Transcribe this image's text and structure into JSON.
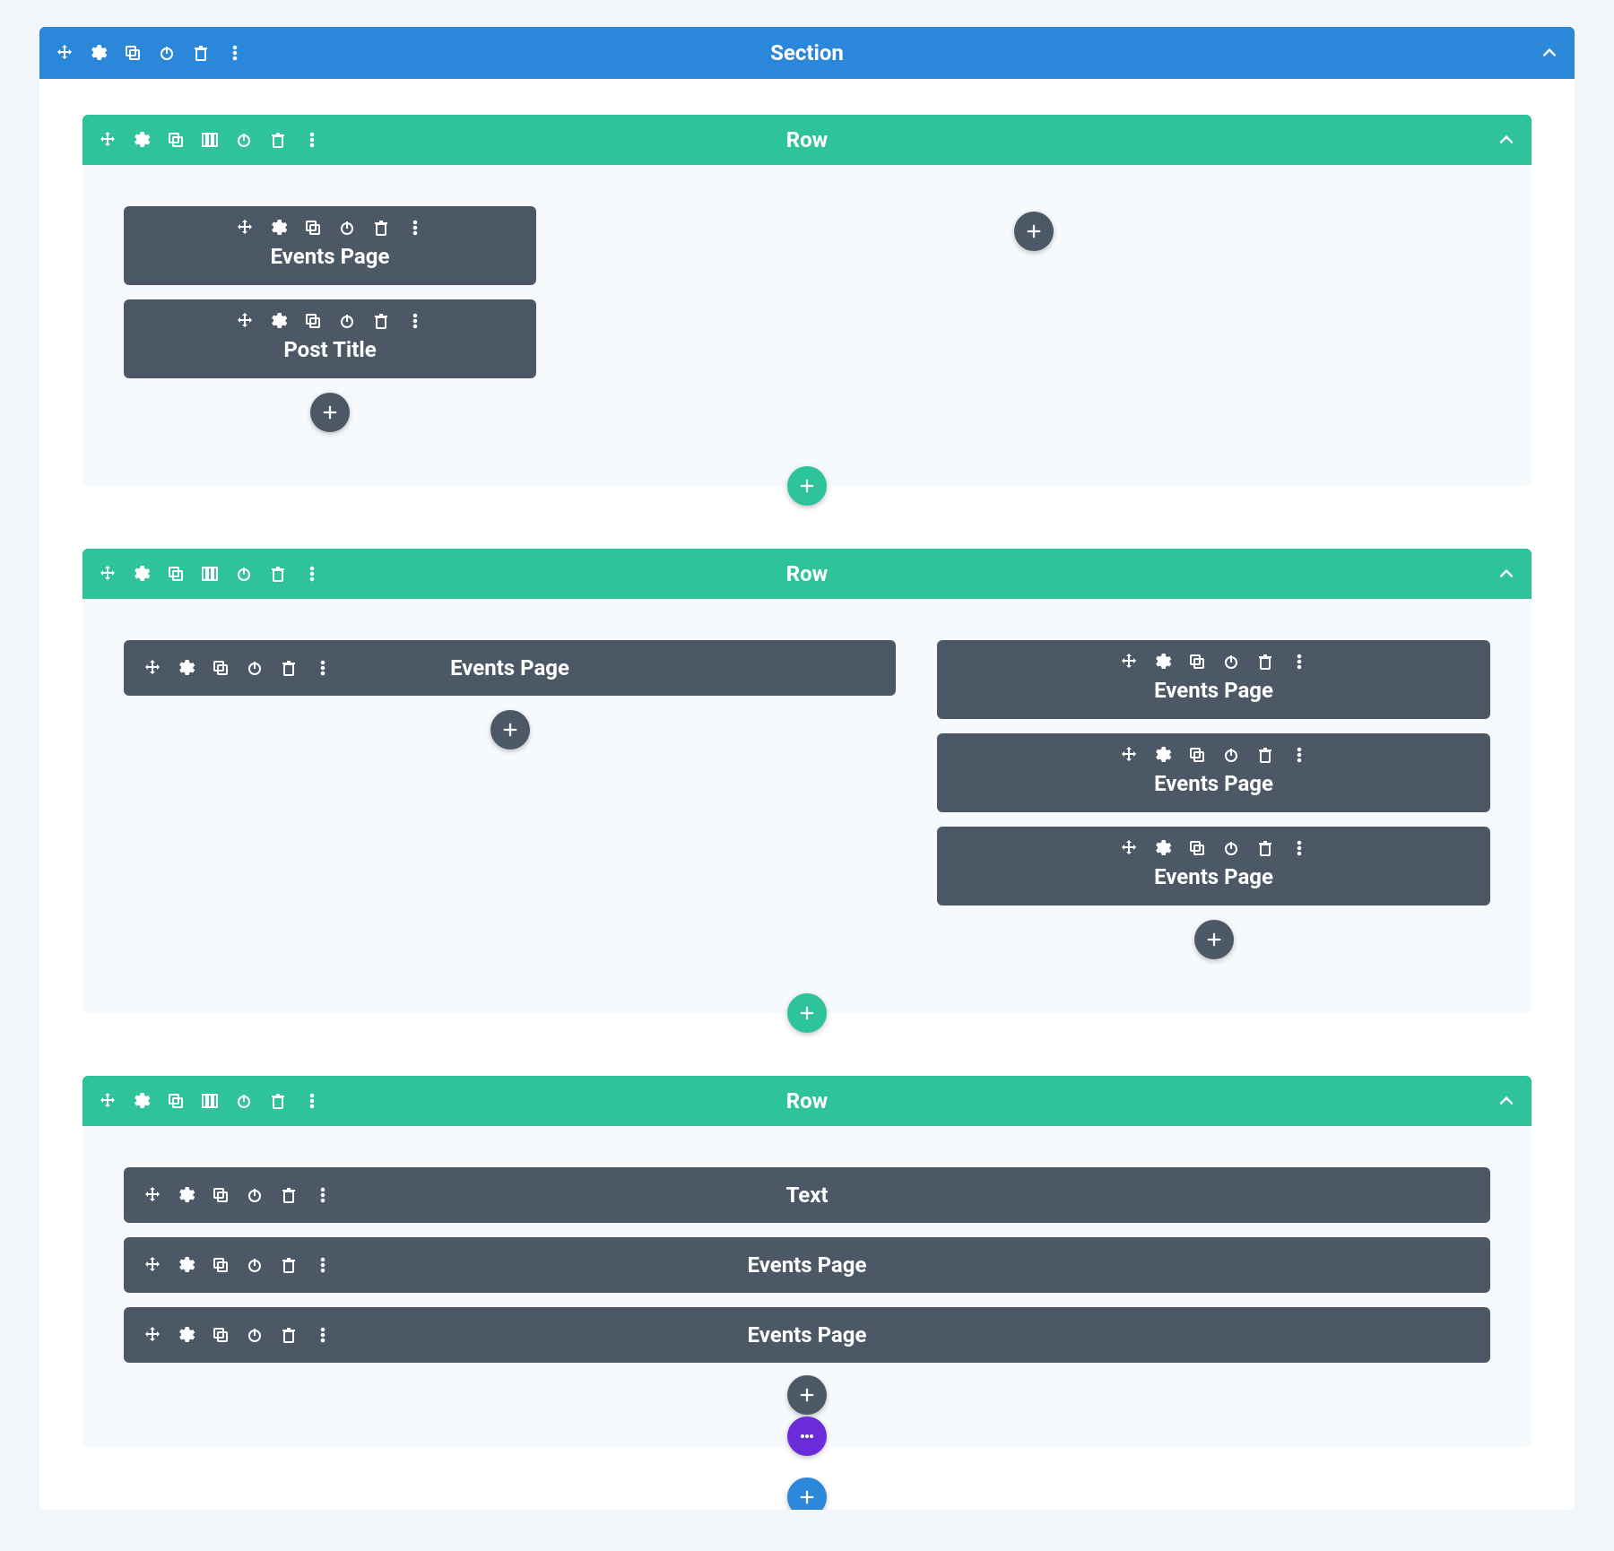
{
  "colors": {
    "section": "#2b87da",
    "row": "#2fc39b",
    "module": "#4c5866",
    "purple": "#6c2bd9",
    "pageBg": "#f2f6f9",
    "sectionBody": "#ffffff",
    "rowBody": "#f7fafc"
  },
  "section": {
    "label": "Section",
    "rows": [
      {
        "label": "Row",
        "columns": [
          {
            "modules": [
              {
                "label": "Events Page"
              },
              {
                "label": "Post Title"
              }
            ]
          },
          {
            "modules": []
          }
        ]
      },
      {
        "label": "Row",
        "columns": [
          {
            "modules": [
              {
                "label": "Events Page"
              }
            ]
          },
          {
            "modules": [
              {
                "label": "Events Page"
              },
              {
                "label": "Events Page"
              },
              {
                "label": "Events Page"
              }
            ]
          }
        ]
      },
      {
        "label": "Row",
        "columns": [
          {
            "modules": [
              {
                "label": "Text"
              },
              {
                "label": "Events Page"
              },
              {
                "label": "Events Page"
              }
            ]
          }
        ]
      }
    ]
  }
}
